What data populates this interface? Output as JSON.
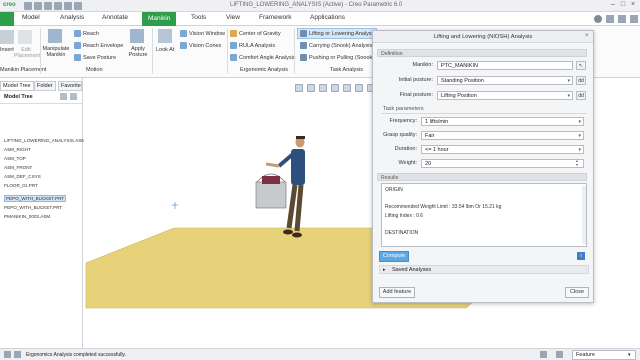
{
  "window": {
    "app_logo": "creo",
    "title": "LIFTING_LOWERING_ANALYSIS (Active) - Creo Parametric 6.0"
  },
  "menu_tabs": [
    "Model",
    "Analysis",
    "Annotate",
    "Manikin",
    "Tools",
    "View",
    "Framework",
    "Applications"
  ],
  "ribbon": {
    "buttons": {
      "insert": "Insert",
      "edit_placement": "Edit Placement",
      "manipulate_manikin": "Manipulate Manikin",
      "reach": "Reach",
      "reach_envelope": "Reach Envelope",
      "save_posture": "Save Posture",
      "apply_posture": "Apply Posture",
      "look_at": "Look At",
      "vision_window": "Vision Window",
      "vision_cones": "Vision Cones",
      "center_of_gravity": "Center of Gravity",
      "rula_analysis": "RULA Analysis",
      "comfort_angle_analysis": "Comfort Angle Analysis",
      "lifting_or_lowering": "Lifting or Lowering Analysis",
      "carrying": "Carrying (Snook) Analysis",
      "pushing_or_pulling": "Pushing or Pulling (Snook) A..."
    },
    "groups": [
      "Manikin Placement",
      "Motion",
      "Ergonomic Analysis",
      "Task Analysis"
    ]
  },
  "left_panel": {
    "tabs": [
      "Model Tree",
      "Folder",
      "Favorites"
    ],
    "header": "Model Tree",
    "items": [
      {
        "label": "LIFTING_LOWERING_ANALYSIS.ASM",
        "selected": false
      },
      {
        "label": "ASM_RIGHT",
        "selected": false
      },
      {
        "label": "ASM_TOP",
        "selected": false
      },
      {
        "label": "ASM_FRONT",
        "selected": false
      },
      {
        "label": "ASM_DEF_CSYS",
        "selected": false
      },
      {
        "label": "FLOOR_01.PRT",
        "selected": false
      },
      {
        "label": "PEPO_WITH_BUCKET.PRT",
        "selected": true
      },
      {
        "label": "PEPO_WITH_BUCKET.PRT",
        "selected": false
      },
      {
        "label": "PMANIKIN_0003.ASM",
        "selected": false
      }
    ]
  },
  "dialog": {
    "title": "Lifting and Lowering (NIOSH) Analysis",
    "definition_section": "Definition",
    "manikin_label": "Manikin:",
    "manikin_value": "PTC_MANIKIN",
    "initial_posture_label": "Initial posture:",
    "initial_posture_value": "Standing Position",
    "final_posture_label": "Final posture:",
    "final_posture_value": "Lifting Position",
    "task_section": "Task parameters",
    "frequency_label": "Frequency:",
    "frequency_value": "1  lifts/min",
    "grasp_label": "Grasp quality:",
    "grasp_value": "Fair",
    "duration_label": "Duration:",
    "duration_value": "<= 1 hour",
    "weight_label": "Weight:",
    "weight_value": "20",
    "results_section": "Results",
    "results_lines": [
      "ORIGIN",
      "",
      "Recommended Weight Limit  : 33.54 lbm Or 15.21 kg",
      "Lifting Index    : 0.6",
      "",
      "DESTINATION"
    ],
    "compute_button": "Compute",
    "saved_analyses": "Saved Analyses",
    "add_feature_button": "Add feature",
    "close_button": "Close"
  },
  "status_bar": {
    "message": "Ergonomics Analysis completed successfully.",
    "filter_value": "Feature"
  },
  "colors": {
    "accent": "#2e9e49",
    "floor": "#e7d27a",
    "selection": "#cfe3f7",
    "compute_button": "#5ba7e3"
  }
}
